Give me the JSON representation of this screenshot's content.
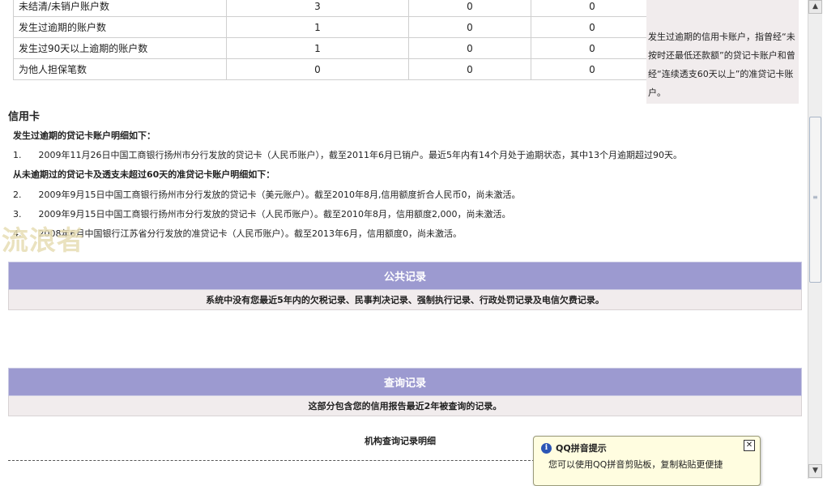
{
  "summary_rows": [
    {
      "label": "未结清/未销户账户数",
      "c1": "3",
      "c2": "0",
      "c3": "0"
    },
    {
      "label": "发生过逾期的账户数",
      "c1": "1",
      "c2": "0",
      "c3": "0"
    },
    {
      "label": "  发生过90天以上逾期的账户数",
      "c1": "1",
      "c2": "0",
      "c3": "0"
    },
    {
      "label": "为他人担保笔数",
      "c1": "0",
      "c2": "0",
      "c3": "0"
    }
  ],
  "side_note": "发生过逾期的信用卡账户，指曾经“未按时还最低还款额”的贷记卡账户和曾经“连续透支60天以上”的准贷记卡账户。",
  "credit_card": {
    "heading": "信用卡",
    "overdue_heading": "发生过逾期的贷记卡账户明细如下：",
    "items_overdue": [
      {
        "num": "1.",
        "text": "2009年11月26日中国工商银行扬州市分行发放的贷记卡（人民币账户），截至2011年6月已销户。最近5年内有14个月处于逾期状态，其中13个月逾期超过90天。"
      }
    ],
    "normal_heading": "从未逾期过的贷记卡及透支未超过60天的准贷记卡账户明细如下：",
    "items_normal": [
      {
        "num": "2.",
        "text": "2009年9月15日中国工商银行扬州市分行发放的贷记卡（美元账户）。截至2010年8月,信用额度折合人民币0，尚未激活。"
      },
      {
        "num": "3.",
        "text": "2009年9月15日中国工商银行扬州市分行发放的贷记卡（人民币账户）。截至2010年8月，信用额度2,000，尚未激活。"
      },
      {
        "num": "4.",
        "text": "2008年6月中国银行江苏省分行发放的准贷记卡（人民币账户）。截至2013年6月，信用额度0，尚未激活。"
      }
    ]
  },
  "watermark": "流浪者",
  "public_record": {
    "title": "公共记录",
    "message": "系统中没有您最近5年内的欠税记录、民事判决记录、强制执行记录、行政处罚记录及电信欠费记录。"
  },
  "query_record": {
    "title": "查询记录",
    "message": "这部分包含您的信用报告最近2年被查询的记录。",
    "sub_title": "机构查询记录明细"
  },
  "popup": {
    "icon": "info-icon",
    "title": "QQ拼音提示",
    "text": "您可以使用QQ拼音剪贴板，复制粘贴更便捷",
    "close": "✕"
  },
  "scrollbar": {
    "up": "▲",
    "down": "▼",
    "grip": "≡"
  }
}
